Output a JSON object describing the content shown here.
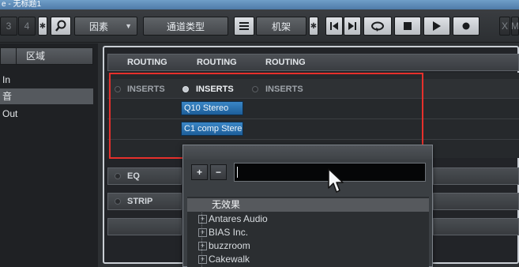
{
  "window": {
    "title": "e - 无标题1"
  },
  "toolbar": {
    "left_buttons": [
      "3",
      "4"
    ],
    "search_icon": "search-icon",
    "filter_dropdown": "因素",
    "channel_type": "通道类型",
    "rack_icon": "menu-icon",
    "rack_label": "机架",
    "transport_icons": [
      "skip-start-icon",
      "skip-end-icon",
      "cycle-icon",
      "stop-icon",
      "play-icon",
      "record-icon"
    ],
    "right_buttons": [
      "X",
      "M"
    ]
  },
  "left_panel": {
    "tab_label": "区域",
    "items": [
      "In",
      "音",
      "Out"
    ]
  },
  "mixer": {
    "routing_labels": [
      "ROUTING",
      "ROUTING",
      "ROUTING"
    ],
    "inserts_labels": [
      "INSERTS",
      "INSERTS",
      "INSERTS"
    ],
    "plugin_slots": [
      "Q10 Stereo",
      "C1 comp Stere"
    ],
    "sections": [
      "EQ",
      "STRIP"
    ]
  },
  "plugin_browser": {
    "add_label": "+",
    "remove_label": "−",
    "search_value": "",
    "items": [
      {
        "label": "无效果",
        "expandable": false
      },
      {
        "label": "Antares Audio",
        "expandable": true
      },
      {
        "label": "BIAS Inc.",
        "expandable": true
      },
      {
        "label": "buzzroom",
        "expandable": true
      },
      {
        "label": "Cakewalk",
        "expandable": true
      }
    ]
  },
  "colors": {
    "highlight": "#e6302c",
    "plugin_slot": "#2a73b4",
    "background": "#2d3033"
  }
}
